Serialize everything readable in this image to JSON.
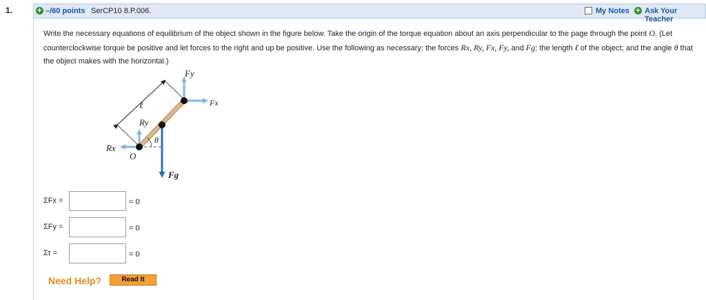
{
  "question": {
    "number": "1.",
    "points": "–/60 points",
    "code": "SerCP10 8.P.006.",
    "my_notes": "My Notes",
    "ask_teacher": "Ask Your Teacher"
  },
  "instructions": {
    "part1": "Write the necessary equations of equilibrium of the object shown in the figure below. Take the origin of the torque equation about an axis perpendicular to the page through the point ",
    "point": "O",
    "part2": ". (Let counterclockwise torque be positive and let forces to the right and up be positive. Use the following as necessary: the forces ",
    "forces": "Rx, Ry, Fx, Fy,",
    "part3": " and ",
    "fg": "Fg",
    "part4": "; the length ",
    "length": "ℓ",
    "part5": " of the object; and the angle ",
    "angle": "θ",
    "part6": " that the object makes with the horizontal.)"
  },
  "figure": {
    "fy": "Fy",
    "fx": "Fx",
    "ell": "ℓ",
    "ry": "Ry",
    "rx": "Rx",
    "o": "O",
    "theta": "θ",
    "fg": "Fg"
  },
  "equations": [
    {
      "label": "ΣFx =",
      "value": "",
      "equals": "= 0"
    },
    {
      "label": "ΣFy =",
      "value": "",
      "equals": "= 0"
    },
    {
      "label": "Στ  =",
      "value": "",
      "equals": "= 0"
    }
  ],
  "help": {
    "need_help": "Need Help?",
    "read_it": "Read It"
  },
  "colors": {
    "header_bg": "#dfe8f3",
    "link": "#1a58a6",
    "arrow": "#7fb8e6",
    "gravity_arrow": "#2b6fb0",
    "rod": "#d9b88c",
    "help": "#e38a1a",
    "button": "#f3a23a"
  }
}
